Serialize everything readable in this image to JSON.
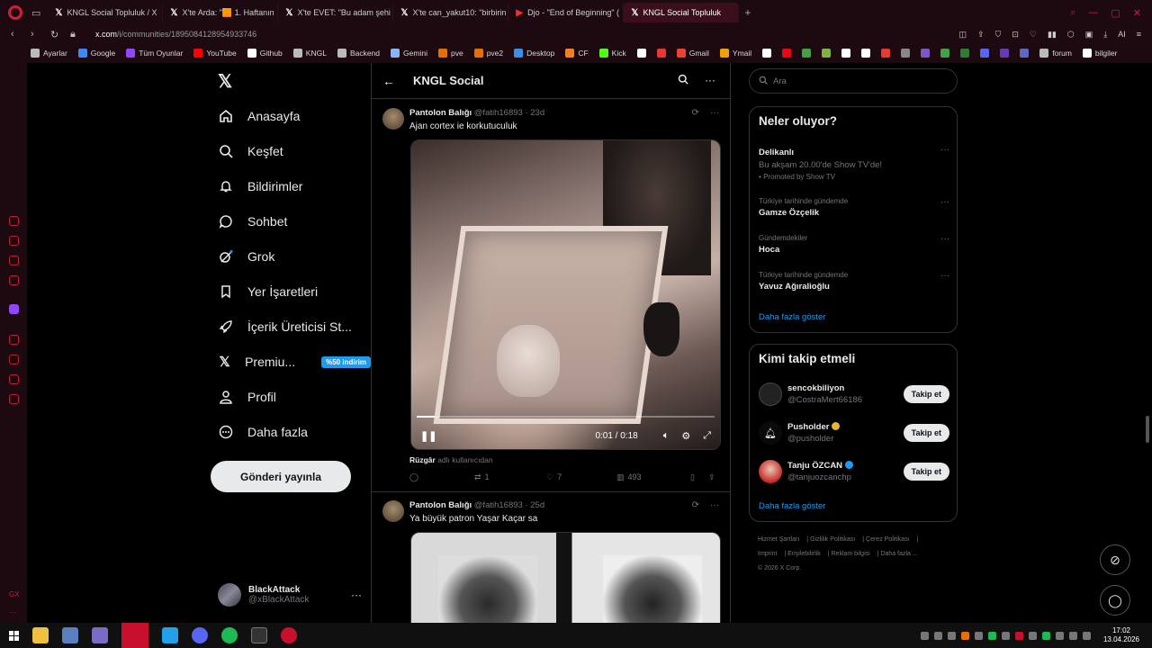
{
  "browser": {
    "tabs": [
      {
        "label": "KNGL Social Topluluk / X",
        "icon": "x"
      },
      {
        "label": "X'te Arda: \"🟧 1. Haftanın",
        "icon": "x"
      },
      {
        "label": "X'te EVET: \"Bu adam şehi",
        "icon": "x"
      },
      {
        "label": "X'te can_yakut10: \"birbirin",
        "icon": "x"
      },
      {
        "label": "Djo - \"End of Beginning\" (",
        "icon": "youtube"
      },
      {
        "label": "KNGL Social Topluluk",
        "icon": "x"
      }
    ],
    "active_tab": 5,
    "url_host": "x.com",
    "url_path": "/i/communities/1895084128954933746",
    "bookmarks": [
      {
        "label": "Ayarlar",
        "icon": "gear-icon",
        "color": "#bbbbbb"
      },
      {
        "label": "Google",
        "icon": "google-icon",
        "color": "#4285f4"
      },
      {
        "label": "Tüm Oyunlar",
        "icon": "twitch-icon",
        "color": "#9146ff"
      },
      {
        "label": "YouTube",
        "icon": "youtube-icon",
        "color": "#ff0000"
      },
      {
        "label": "Github",
        "icon": "github-icon",
        "color": "#ffffff"
      },
      {
        "label": "KNGL",
        "icon": "folder-icon",
        "color": "#bbbbbb"
      },
      {
        "label": "Backend",
        "icon": "folder-icon",
        "color": "#bbbbbb"
      },
      {
        "label": "Gemini",
        "icon": "gemini-icon",
        "color": "#8ab4f8"
      },
      {
        "label": "pve",
        "icon": "proxmox-icon",
        "color": "#e57000"
      },
      {
        "label": "pve2",
        "icon": "proxmox-icon",
        "color": "#e57000"
      },
      {
        "label": "Desktop",
        "icon": "desktop-icon",
        "color": "#3a8ee6"
      },
      {
        "label": "CF",
        "icon": "cloudflare-icon",
        "color": "#f38020"
      },
      {
        "label": "Kick",
        "icon": "kick-icon",
        "color": "#53fc18"
      },
      {
        "label": "",
        "icon": "g-icon",
        "color": "#ffffff"
      },
      {
        "label": "",
        "icon": "red-square-icon",
        "color": "#e53935"
      },
      {
        "label": "Gmail",
        "icon": "gmail-icon",
        "color": "#ea4335"
      },
      {
        "label": "Ymail",
        "icon": "ymail-icon",
        "color": "#f0a000"
      },
      {
        "label": "",
        "icon": "x-icon",
        "color": "#ffffff"
      },
      {
        "label": "",
        "icon": "netflix-icon",
        "color": "#e50914"
      },
      {
        "label": "",
        "icon": "chart-icon",
        "color": "#43a047"
      },
      {
        "label": "",
        "icon": "bars-icon",
        "color": "#7cb342"
      },
      {
        "label": "",
        "icon": "p-icon",
        "color": "#ffffff"
      },
      {
        "label": "",
        "icon": "w-icon",
        "color": "#ffffff"
      },
      {
        "label": "",
        "icon": "h-icon",
        "color": "#e53935"
      },
      {
        "label": "",
        "icon": "arrow-icon",
        "color": "#888888"
      },
      {
        "label": "",
        "icon": "purple-icon",
        "color": "#7e57c2"
      },
      {
        "label": "",
        "icon": "plus-icon",
        "color": "#43a047"
      },
      {
        "label": "",
        "icon": "sheet-icon",
        "color": "#2e7d32"
      },
      {
        "label": "",
        "icon": "discord-icon",
        "color": "#5865f2"
      },
      {
        "label": "",
        "icon": "vivid-icon",
        "color": "#673ab7"
      },
      {
        "label": "",
        "icon": "tool-icon",
        "color": "#5c6bc0"
      },
      {
        "label": "forum",
        "icon": "forum-icon",
        "color": "#bbbbbb"
      },
      {
        "label": "bilgiler",
        "icon": "github-icon",
        "color": "#ffffff"
      }
    ]
  },
  "nav": {
    "items": [
      {
        "label": "Anasayfa",
        "icon": "home-icon"
      },
      {
        "label": "Keşfet",
        "icon": "search-icon"
      },
      {
        "label": "Bildirimler",
        "icon": "bell-icon"
      },
      {
        "label": "Sohbet",
        "icon": "chat-icon"
      },
      {
        "label": "Grok",
        "icon": "grok-icon"
      },
      {
        "label": "Yer İşaretleri",
        "icon": "bookmark-icon"
      },
      {
        "label": "İçerik Üreticisi St...",
        "icon": "rocket-icon"
      },
      {
        "label": "Premiu...",
        "icon": "x-premium-icon"
      },
      {
        "label": "Profil",
        "icon": "person-icon"
      },
      {
        "label": "Daha fazla",
        "icon": "more-circle-icon"
      }
    ],
    "premium_badge": "%50 indirim",
    "post_button": "Gönderi yayınla",
    "account_name": "BlackAttack",
    "account_handle": "@xBlackAttack"
  },
  "feed": {
    "title": "KNGL Social",
    "tweets": [
      {
        "name": "Pantolon Balığı",
        "handle": "@fatih16893",
        "time": "23d",
        "text": "Ajan cortex ie korkutuculuk",
        "video_time": "0:01 / 0:18",
        "video_progress": 0.06,
        "attribution_user": "Rüzgâr",
        "attribution_suffix": "adlı kullanıcıdan",
        "replies": "",
        "reposts": "1",
        "likes": "7",
        "views": "493"
      },
      {
        "name": "Pantolon Balığı",
        "handle": "@fatih16893",
        "time": "25d",
        "text": "Ya büyük patron Yaşar Kaçar sa"
      }
    ]
  },
  "right": {
    "search_placeholder": "Ara",
    "trends_title": "Neler oluyor?",
    "trends": [
      {
        "context": "",
        "title": "Delikanlı",
        "subtitle": "Bu akşam 20.00'de Show TV'de!",
        "promo": "Promoted by Show TV"
      },
      {
        "context": "Türkiye tarihinde gündemde",
        "title": "Gamze Özçelik"
      },
      {
        "context": "Gündemdekiler",
        "title": "Hoca"
      },
      {
        "context": "Türkiye tarihinde gündemde",
        "title": "Yavuz Ağıralioğlu"
      }
    ],
    "show_more": "Daha fazla göster",
    "who_title": "Kimi takip etmeli",
    "who": [
      {
        "name": "sencokbiliyon",
        "handle": "@CostraMert66186",
        "badge": "",
        "avatar": "#222222"
      },
      {
        "name": "Pusholder",
        "handle": "@pusholder",
        "badge": "gold",
        "avatar": "#0a0a0a"
      },
      {
        "name": "Tanju ÖZCAN",
        "handle": "@tanjuozcanchp",
        "badge": "blue",
        "avatar": "#c62828"
      }
    ],
    "follow_label": "Takip et",
    "who_show_more": "Daha fazla göster",
    "footer": [
      "Hizmet Şartları",
      "Gizlilik Politikası",
      "Çerez Politikası",
      "Imprint",
      "Erişilebilirlik",
      "Reklam bilgisi",
      "Daha fazla ...",
      "© 2026 X Corp."
    ]
  },
  "taskbar": {
    "time": "17:02",
    "date": "13.04.2026"
  },
  "colors": {
    "accent": "#1d9bf0",
    "opera_red": "#c8102e"
  }
}
